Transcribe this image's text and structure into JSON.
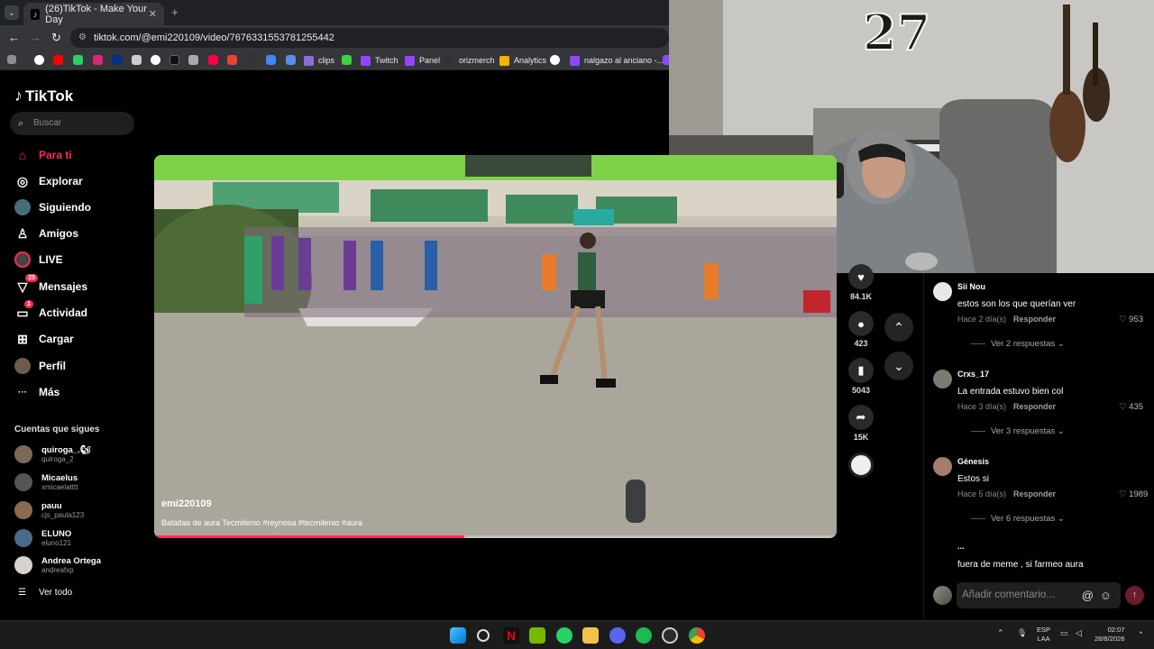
{
  "browser": {
    "tab_title": "(26)TikTok - Make Your Day",
    "tab_close": "✕",
    "new_tab": "+",
    "url": "tiktok.com/@emi220109/video/7676331553781255442",
    "bookmarks": [
      {
        "label": "clips",
        "color": "#8e6bd8"
      },
      {
        "label": "",
        "color": "#3ad43a"
      },
      {
        "label": "Twitch",
        "color": "#9147ff"
      },
      {
        "label": "Panel",
        "color": "#9147ff"
      },
      {
        "label": "orizmerch",
        "color": "#333333"
      },
      {
        "label": "Analytics",
        "color": "#f4b400"
      },
      {
        "label": "",
        "color": "#ffffff"
      },
      {
        "label": "nalgazo al anciano -...",
        "color": "#9147ff"
      }
    ]
  },
  "sidebar": {
    "logo": "TikTok",
    "search_placeholder": "Buscar",
    "nav": [
      {
        "label": "Para ti",
        "icon": "home-icon",
        "glyph": "⌂",
        "active": true,
        "badge": ""
      },
      {
        "label": "Explorar",
        "icon": "compass-icon",
        "glyph": "◎",
        "active": false,
        "badge": ""
      },
      {
        "label": "Siguiendo",
        "icon": "following-avatar-icon",
        "glyph": "●",
        "active": false,
        "badge": ""
      },
      {
        "label": "Amigos",
        "icon": "friends-icon",
        "glyph": "♙",
        "active": false,
        "badge": ""
      },
      {
        "label": "LIVE",
        "icon": "live-icon",
        "glyph": "◉",
        "active": false,
        "badge": ""
      },
      {
        "label": "Mensajes",
        "icon": "messages-icon",
        "glyph": "▽",
        "active": false,
        "badge": "25"
      },
      {
        "label": "Actividad",
        "icon": "activity-icon",
        "glyph": "▭",
        "active": false,
        "badge": "1"
      },
      {
        "label": "Cargar",
        "icon": "upload-icon",
        "glyph": "⊞",
        "active": false,
        "badge": ""
      },
      {
        "label": "Perfil",
        "icon": "profile-avatar-icon",
        "glyph": "●",
        "active": false,
        "badge": ""
      },
      {
        "label": "Más",
        "icon": "more-icon",
        "glyph": "···",
        "active": false,
        "badge": ""
      }
    ],
    "following_title": "Cuentas que sigues",
    "following": [
      {
        "name": "quiroga_.🐿",
        "handle": "quiroga_2",
        "color": "#7a6a55"
      },
      {
        "name": "Micaelus",
        "handle": "xmicaelatttt",
        "color": "#555555"
      },
      {
        "name": "pauu",
        "handle": "cjs_paula123",
        "color": "#8a6a50"
      },
      {
        "name": "ELUNO",
        "handle": "eluno121",
        "color": "#4a6a8a"
      },
      {
        "name": "Andrea Ortega",
        "handle": "andreafxp",
        "color": "#d8d2cc"
      }
    ],
    "see_all_icon": "☰",
    "see_all": "Ver todo"
  },
  "video": {
    "author": "emi220109",
    "caption": "Batallas de aura Tecmilenio #reynosa #tecmilenio #aura",
    "progress": 0.455
  },
  "actions": [
    {
      "icon": "heart-icon",
      "glyph": "♥",
      "count": "84.1K"
    },
    {
      "icon": "comment-icon",
      "glyph": "●",
      "count": "423"
    },
    {
      "icon": "bookmark-icon",
      "glyph": "▮",
      "count": "5043"
    },
    {
      "icon": "share-icon",
      "glyph": "➦",
      "count": "15K"
    }
  ],
  "nav_arrows": {
    "up": "⌃",
    "down": "⌄"
  },
  "comments": [
    {
      "user": "Sii Nou",
      "text": "estos son los que querían ver",
      "time": "Hace 2 día(s)",
      "reply": "Responder",
      "likes": "♡ 953",
      "more": "Ver 2 respuestas ⌄",
      "avatar_color": "#e8e8e8"
    },
    {
      "user": "Crxs_17",
      "text": "La entrada estuvo bien col",
      "time": "Hace 3 día(s)",
      "reply": "Responder",
      "likes": "♡ 435",
      "more": "Ver 3 respuestas ⌄",
      "avatar_color": "#7c7a72"
    },
    {
      "user": "Génesis",
      "text": "Estos si",
      "time": "Hace 5 día(s)",
      "reply": "Responder",
      "likes": "♡ 1989",
      "more": "Ver 6 respuestas ⌄",
      "avatar_color": "#a67c6a"
    }
  ],
  "partial_comment": {
    "user": "...",
    "text": "fuera de meme , si farmeo aura"
  },
  "comment_input": {
    "placeholder": "Añadir comentario...",
    "at": "@",
    "emoji": "☺",
    "send": "↑"
  },
  "taskbar": {
    "lang": "ESP",
    "lang2": "LAA",
    "time": "02:07",
    "date": "28/8/2026"
  }
}
